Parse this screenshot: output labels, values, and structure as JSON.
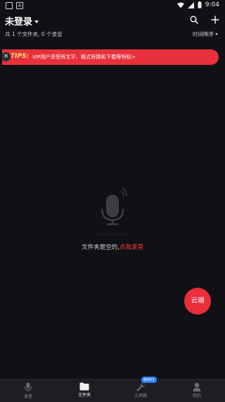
{
  "status_bar": {
    "time": "9:04",
    "notification_letter": "A"
  },
  "header": {
    "title": "未登录"
  },
  "info": {
    "summary": "共 1 个文件夹, 0 个录音",
    "sort_label": "时间降序"
  },
  "tips": {
    "label": "TIPS:",
    "text": "VIP用户享受转文字、格式转换和下载等特权>"
  },
  "empty_state": {
    "message": "文件夹是空的,",
    "action": "点我录音"
  },
  "cloud_button": {
    "label": "云端"
  },
  "bottom_nav": {
    "items": [
      {
        "label": "录音",
        "icon": "mic-icon",
        "active": false
      },
      {
        "label": "文件夹",
        "icon": "folder-icon",
        "active": true
      },
      {
        "label": "工具箱",
        "icon": "wrench-icon",
        "active": false,
        "badge": "转MP3"
      },
      {
        "label": "我的",
        "icon": "user-icon",
        "active": false
      }
    ]
  },
  "colors": {
    "background": "#101114",
    "accent": "#e8313c",
    "tips_label": "#ffe066",
    "badge": "#2f80ff"
  }
}
